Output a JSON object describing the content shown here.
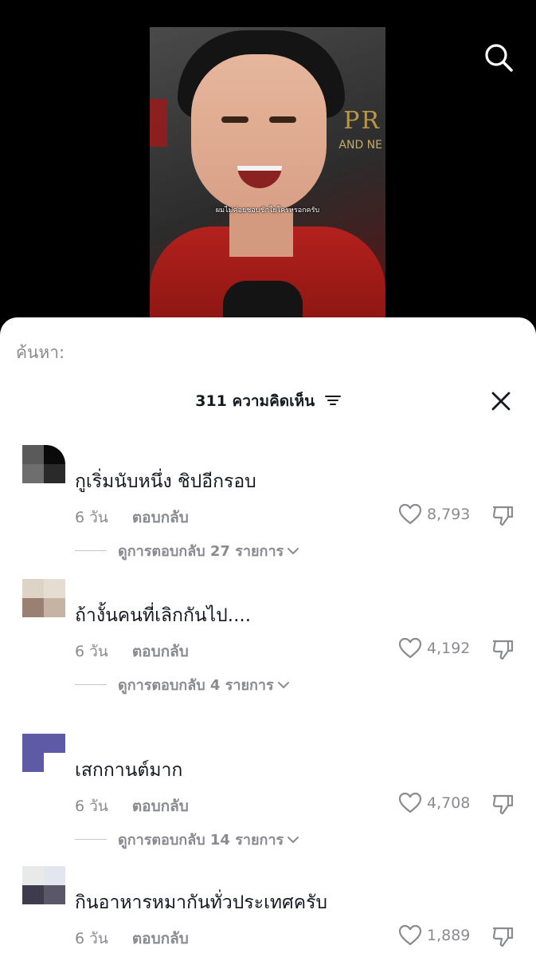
{
  "video": {
    "subtitle": "ผมไม่ค่อยชอบชักใยใครหรอกครับ",
    "bg_text": "PR",
    "bg_text2": "AND NE"
  },
  "search": {
    "label": "ค้นหา:"
  },
  "comments_header": {
    "title": "311 ความคิดเห็น"
  },
  "comments": [
    {
      "text": "กูเริ่มนับหนึ่ง ชิปอีกรอบ",
      "time": "6 วัน",
      "reply_label": "ตอบกลับ",
      "likes": "8,793",
      "view_replies": "ดูการตอบกลับ 27 รายการ",
      "avatar_colors": [
        "#5a5a5a",
        "#0a0a0a",
        "#6e6e6e",
        "#2a2a2a"
      ]
    },
    {
      "text": "ถ้างั้นคนที่เลิกกันไป....",
      "time": "6 วัน",
      "reply_label": "ตอบกลับ",
      "likes": "4,192",
      "view_replies": "ดูการตอบกลับ 4 รายการ",
      "avatar_colors": [
        "#ddd3c6",
        "#e6ddd2",
        "#9a8070",
        "#c6b3a4"
      ]
    },
    {
      "text": "เสกกานต์มาก",
      "time": "6 วัน",
      "reply_label": "ตอบกลับ",
      "likes": "4,708",
      "view_replies": "ดูการตอบกลับ 14 รายการ",
      "avatar_colors": [
        "#5f5aa6",
        "#5f5aa6",
        "#5f5aa6",
        "#ffffff"
      ]
    },
    {
      "text": "กินอาหารหมากันทั่วประเทศครับ",
      "time": "6 วัน",
      "reply_label": "ตอบกลับ",
      "likes": "1,889",
      "view_replies": "",
      "avatar_colors": [
        "#e8eae9",
        "#e2e6ee",
        "#3e3b4c",
        "#5a5868"
      ]
    }
  ]
}
